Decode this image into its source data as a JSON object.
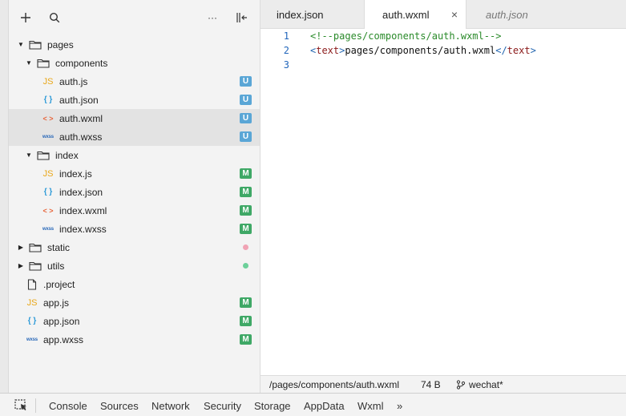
{
  "toolbar": {
    "add_icon": "plus-icon",
    "search_icon": "search-icon",
    "more_label": "···",
    "collapse_icon": "collapse-panel-icon"
  },
  "tree": [
    {
      "label": "pages",
      "type": "folder",
      "expanded": true,
      "depth": 0
    },
    {
      "label": "components",
      "type": "folder",
      "expanded": true,
      "depth": 1
    },
    {
      "label": "auth.js",
      "type": "js",
      "icon": "JS",
      "depth": 2,
      "badge": "U"
    },
    {
      "label": "auth.json",
      "type": "json",
      "icon": "{ }",
      "depth": 2,
      "badge": "U"
    },
    {
      "label": "auth.wxml",
      "type": "wxml",
      "icon": "< >",
      "depth": 2,
      "badge": "U",
      "selected": true
    },
    {
      "label": "auth.wxss",
      "type": "wxss",
      "icon": "wxss",
      "depth": 2,
      "badge": "U",
      "selected": true
    },
    {
      "label": "index",
      "type": "folder",
      "expanded": true,
      "depth": 1
    },
    {
      "label": "index.js",
      "type": "js",
      "icon": "JS",
      "depth": 2,
      "badge": "M"
    },
    {
      "label": "index.json",
      "type": "json",
      "icon": "{ }",
      "depth": 2,
      "badge": "M"
    },
    {
      "label": "index.wxml",
      "type": "wxml",
      "icon": "< >",
      "depth": 2,
      "badge": "M"
    },
    {
      "label": "index.wxss",
      "type": "wxss",
      "icon": "wxss",
      "depth": 2,
      "badge": "M"
    },
    {
      "label": "static",
      "type": "folder",
      "expanded": false,
      "depth": 0,
      "dot": "#f0a3b4"
    },
    {
      "label": "utils",
      "type": "folder",
      "expanded": false,
      "depth": 0,
      "dot": "#6cd09a"
    },
    {
      "label": ".project",
      "type": "file",
      "depth": 0
    },
    {
      "label": "app.js",
      "type": "js",
      "icon": "JS",
      "depth": 0,
      "badge": "M"
    },
    {
      "label": "app.json",
      "type": "json",
      "icon": "{ }",
      "depth": 0,
      "badge": "M"
    },
    {
      "label": "app.wxss",
      "type": "wxss",
      "icon": "wxss",
      "depth": 0,
      "badge": "M"
    }
  ],
  "tabs": [
    {
      "label": "index.json",
      "active": false,
      "preview": false
    },
    {
      "label": "auth.wxml",
      "active": true,
      "preview": false,
      "close": "×"
    },
    {
      "label": "auth.json",
      "active": false,
      "preview": true
    }
  ],
  "editor": {
    "lines": [
      {
        "num": "1",
        "comment": "<!--pages/components/auth.wxml-->"
      },
      {
        "num": "2",
        "open_lt": "<",
        "open_tag": "text",
        "open_gt": ">",
        "text": "pages/components/auth.wxml",
        "close_lt": "</",
        "close_tag": "text",
        "close_gt": ">"
      },
      {
        "num": "3"
      }
    ]
  },
  "status": {
    "path": "/pages/components/auth.wxml",
    "size": "74 B",
    "branch": "wechat*"
  },
  "devtools": {
    "tabs": [
      "Console",
      "Sources",
      "Network",
      "Security",
      "Storage",
      "AppData",
      "Wxml"
    ],
    "more": "»"
  },
  "colors": {
    "badge_u": "#5aa6d6",
    "badge_m": "#3fa866",
    "comment": "#2a8a2a",
    "tag": "#8b1a1a"
  }
}
